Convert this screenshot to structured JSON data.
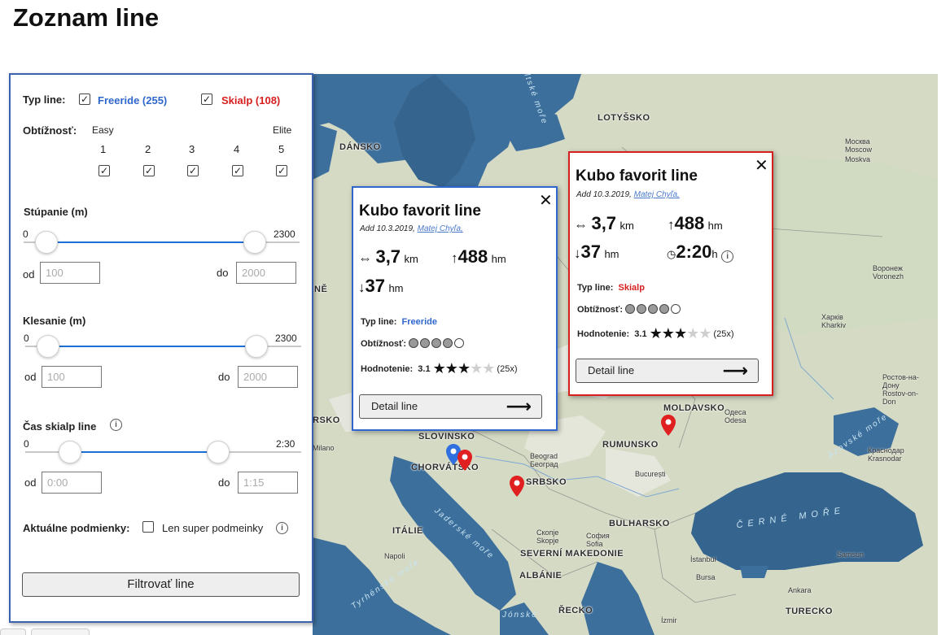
{
  "page_title": "Zoznam line",
  "filter": {
    "type_label": "Typ line:",
    "freeride_label": "Freeride (255)",
    "skialp_label": "Skialp (108)",
    "freeride_checked": true,
    "skialp_checked": true,
    "difficulty_label": "Obtížnosť:",
    "easy_label": "Easy",
    "elite_label": "Elite",
    "levels": [
      "1",
      "2",
      "3",
      "4",
      "5"
    ],
    "check_mark": "✓",
    "ascent": {
      "label": "Stúpanie (m)",
      "min": "0",
      "max": "2300",
      "from_label": "od",
      "to_label": "do",
      "from_placeholder": "100",
      "to_placeholder": "2000",
      "from_value": 100,
      "to_value": 2000,
      "range_max": 2300
    },
    "descent": {
      "label": "Klesanie (m)",
      "min": "0",
      "max": "2300",
      "from_label": "od",
      "to_label": "do",
      "from_placeholder": "100",
      "to_placeholder": "2000",
      "from_value": 100,
      "to_value": 2000,
      "range_max": 2300
    },
    "skialp_time": {
      "label": "Čas skialp line",
      "min": "0",
      "max": "2:30",
      "from_label": "od",
      "to_label": "do",
      "from_placeholder": "0:00",
      "to_placeholder": "1:15"
    },
    "conditions_label": "Aktuálne podmienky:",
    "super_conditions_label": "Len super podmeinky",
    "info_glyph": "i",
    "submit_label": "Filtrovať line"
  },
  "map": {
    "countries": [
      {
        "name": "LOTYŠSKO",
        "key": "lv"
      },
      {
        "name": "DÁNSKO",
        "key": "dk"
      },
      {
        "name": "SLOVINSKO",
        "key": "si"
      },
      {
        "name": "CHORVÁTSKO",
        "key": "hr"
      },
      {
        "name": "SRBSKO",
        "key": "rs"
      },
      {
        "name": "RUMUNSKO",
        "key": "ro"
      },
      {
        "name": "MOLDAVSKO",
        "key": "md"
      },
      {
        "name": "BULHARSKO",
        "key": "bg"
      },
      {
        "name": "ITÁLIE",
        "key": "it"
      },
      {
        "name": "SEVERNÍ MAKEDONIE",
        "key": "mk"
      },
      {
        "name": "ALBÁNIE",
        "key": "al"
      },
      {
        "name": "ŘECKO",
        "key": "gr"
      },
      {
        "name": "TURECKO",
        "key": "tr"
      },
      {
        "name": "NĚ",
        "key": "de"
      },
      {
        "name": "RSKO",
        "key": "hu"
      }
    ],
    "cities": [
      {
        "name": "Москва\nMoscow",
        "key": "moscow"
      },
      {
        "name": "Moskva",
        "key": "moskva"
      },
      {
        "name": "Воронеж\nVoronezh",
        "key": "voronezh"
      },
      {
        "name": "Харків\nKharkiv",
        "key": "kharkiv"
      },
      {
        "name": "Ростов-на-\nДону\nRostov-on-\nDon",
        "key": "rostov"
      },
      {
        "name": "Краснодар\nKrasnodar",
        "key": "krasnodar"
      },
      {
        "name": "Одеса\nOdesa",
        "key": "odesa"
      },
      {
        "name": "Beograd\nБеоград",
        "key": "beograd"
      },
      {
        "name": "București",
        "key": "bucuresti"
      },
      {
        "name": "София\nSofia",
        "key": "sofia"
      },
      {
        "name": "Скопје\nSkopje",
        "key": "skopje"
      },
      {
        "name": "İstanbul",
        "key": "istanbul"
      },
      {
        "name": "Bursa",
        "key": "bursa"
      },
      {
        "name": "Ankara",
        "key": "ankara"
      },
      {
        "name": "Samsun",
        "key": "samsun"
      },
      {
        "name": "İzmir",
        "key": "izmir"
      },
      {
        "name": "Milano",
        "key": "milano"
      },
      {
        "name": "Napoli",
        "key": "napoli"
      }
    ],
    "seas": [
      {
        "name": "Baltské moře",
        "key": "baltic"
      },
      {
        "name": "ČERNÉ MOŘE",
        "key": "black"
      },
      {
        "name": "Jaderské moře",
        "key": "adriatic"
      },
      {
        "name": "Azovské moře",
        "key": "azov"
      },
      {
        "name": "Tyrhénské moře",
        "key": "tyrrhenian"
      },
      {
        "name": "Jónské",
        "key": "ionian"
      }
    ],
    "marker_colors": {
      "freeride": "#2f6fe0",
      "skialp": "#e02020"
    }
  },
  "popups": [
    {
      "key": "freeride",
      "title": "Kubo favorit line",
      "added": "Add 10.3.2019,",
      "author": "Matej Chyľa,",
      "distance": "3,7",
      "distance_unit": "km",
      "ascent": "488",
      "ascent_unit": "hm",
      "descent": "37",
      "descent_unit": "hm",
      "type_label": "Typ line:",
      "type_value": "Freeride",
      "type_color": "#2f67cc",
      "difficulty_label": "Obtížnosť:",
      "difficulty": 4,
      "difficulty_max": 5,
      "rating_label": "Hodnotenie:",
      "rating": "3.1",
      "stars": 3,
      "stars_max": 5,
      "votes": "(25x)",
      "detail_label": "Detail line",
      "close_glyph": "✕"
    },
    {
      "key": "skialp",
      "title": "Kubo favorit line",
      "added": "Add 10.3.2019,",
      "author": "Matej Chyľa,",
      "distance": "3,7",
      "distance_unit": "km",
      "ascent": "488",
      "ascent_unit": "hm",
      "descent": "37",
      "descent_unit": "hm",
      "time": "2:20",
      "time_unit": "h",
      "type_label": "Typ line:",
      "type_value": "Skialp",
      "type_color": "#d62020",
      "difficulty_label": "Obtížnosť:",
      "difficulty": 4,
      "difficulty_max": 5,
      "rating_label": "Hodnotenie:",
      "rating": "3.1",
      "stars": 3,
      "stars_max": 5,
      "votes": "(25x)",
      "detail_label": "Detail line",
      "close_glyph": "✕"
    }
  ]
}
